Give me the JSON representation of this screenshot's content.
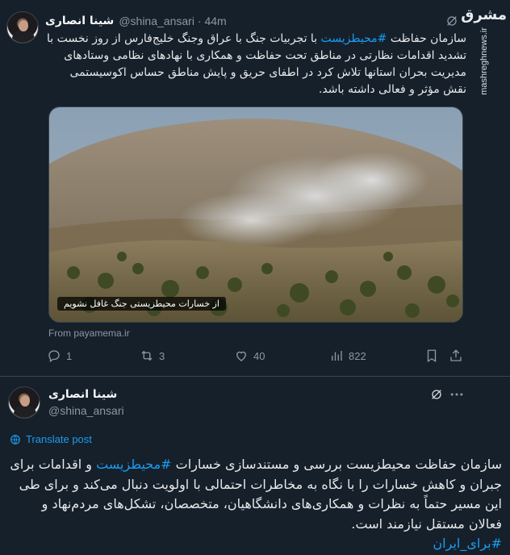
{
  "tweet1": {
    "author_name": "شینا انصاری",
    "handle": "@shina_ansari",
    "time": "· 44m",
    "text_before_tag": "سازمان حفاظت ",
    "hashtag": "#محیطزیست",
    "text_after_tag": " با تجربیات جنگ با عراق وجنگ خلیج‌فارس از روز نخست با تشدید اقدامات نظارتی در مناطق تحت حفاظت و همکاری با نهادهای نظامی وستادهای مدیریت بحران استانها تلاش کرد در اطفای حریق و پایش مناطق حساس اکوسیستمی نقش مؤثر و فعالی داشته باشد.",
    "image_caption": "از خسارات محیطزیستی جنگ غافل نشویم",
    "link_source": "From payamema.ir",
    "replies": "1",
    "reposts": "3",
    "likes": "40",
    "views": "822"
  },
  "watermark": {
    "logo": "مشرق",
    "url": "mashreghnews.ir"
  },
  "tweet2": {
    "author_name": "شینا انصاری",
    "handle": "@shina_ansari",
    "translate_label": "Translate post",
    "text_before_tag": "سازمان حفاظت محیطزیست بررسی و مستندسازی خسارات ",
    "hashtag": "#محیطزیست",
    "text_after_tag": " و اقدامات برای جبران و کاهش خسارات را با نگاه به مخاطرات احتمالی با اولویت دنبال می‌کند و برای طی این مسیر حتماً به نظرات و همکاری‌های دانشگاهیان، متخصصان، تشکل‌های مردم‌نهاد و فعالان مستقل نیازمند است.",
    "hashtag2": "#برای_ایران"
  },
  "colors": {
    "background": "#15202b",
    "link": "#1d9bf0",
    "muted": "#8b98a5",
    "border": "#38444d"
  },
  "icons": [
    "grok-icon",
    "reply-icon",
    "repost-icon",
    "like-icon",
    "views-icon",
    "bookmark-icon",
    "share-icon",
    "more-icon",
    "translate-icon"
  ]
}
